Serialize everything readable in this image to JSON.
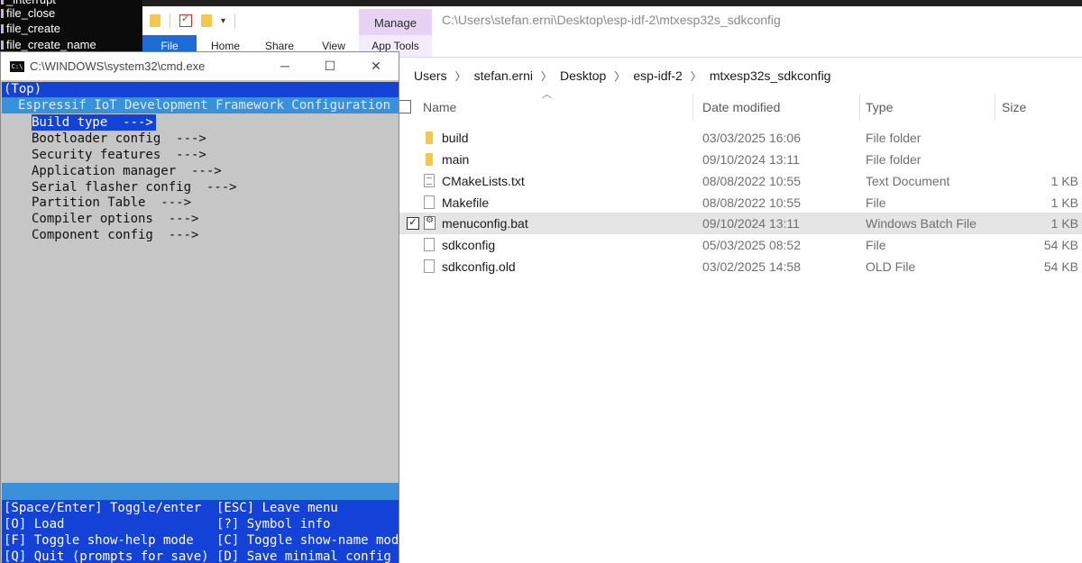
{
  "editor": {
    "sidebar_items": [
      "_interrupt",
      "file_close",
      "file_create",
      "file_create_name"
    ]
  },
  "explorer": {
    "window_path": "C:\\Users\\stefan.erni\\Desktop\\esp-idf-2\\mtxesp32s_sdkconfig",
    "ribbon": {
      "manage_label": "Manage",
      "tabs": [
        "File",
        "Home",
        "Share",
        "View",
        "App Tools"
      ]
    },
    "breadcrumb": [
      "Users",
      "stefan.erni",
      "Desktop",
      "esp-idf-2",
      "mtxesp32s_sdkconfig"
    ],
    "columns": [
      "Name",
      "Date modified",
      "Type",
      "Size"
    ],
    "files": [
      {
        "name": "build",
        "date": "03/03/2025 16:06",
        "type": "File folder",
        "size": "",
        "icon": "folder-icon"
      },
      {
        "name": "main",
        "date": "09/10/2024 13:11",
        "type": "File folder",
        "size": "",
        "icon": "folder-icon"
      },
      {
        "name": "CMakeLists.txt",
        "date": "08/08/2022 10:55",
        "type": "Text Document",
        "size": "1 KB",
        "icon": "text-file-icon"
      },
      {
        "name": "Makefile",
        "date": "08/08/2022 10:55",
        "type": "File",
        "size": "1 KB",
        "icon": "file-icon"
      },
      {
        "name": "menuconfig.bat",
        "date": "09/10/2024 13:11",
        "type": "Windows Batch File",
        "size": "1 KB",
        "icon": "batch-file-icon",
        "selected": true
      },
      {
        "name": "sdkconfig",
        "date": "05/03/2025 08:52",
        "type": "File",
        "size": "54 KB",
        "icon": "file-icon"
      },
      {
        "name": "sdkconfig.old",
        "date": "03/02/2025 14:58",
        "type": "OLD File",
        "size": "54 KB",
        "icon": "file-icon"
      }
    ]
  },
  "cmd": {
    "title": "C:\\WINDOWS\\system32\\cmd.exe",
    "top_line": "(Top)",
    "header": "Espressif IoT Development Framework Configuration",
    "menu": [
      "Build type  --->",
      "Bootloader config  --->",
      "Security features  --->",
      "Application manager  --->",
      "Serial flasher config  --->",
      "Partition Table  --->",
      "Compiler options  --->",
      "Component config  --->"
    ],
    "help": [
      "[Space/Enter] Toggle/enter  [ESC] Leave menu",
      "[O] Load                    [?] Symbol info",
      "[F] Toggle show-help mode   [C] Toggle show-name mode",
      "[Q] Quit (prompts for save) [D] Save minimal config ("
    ]
  }
}
